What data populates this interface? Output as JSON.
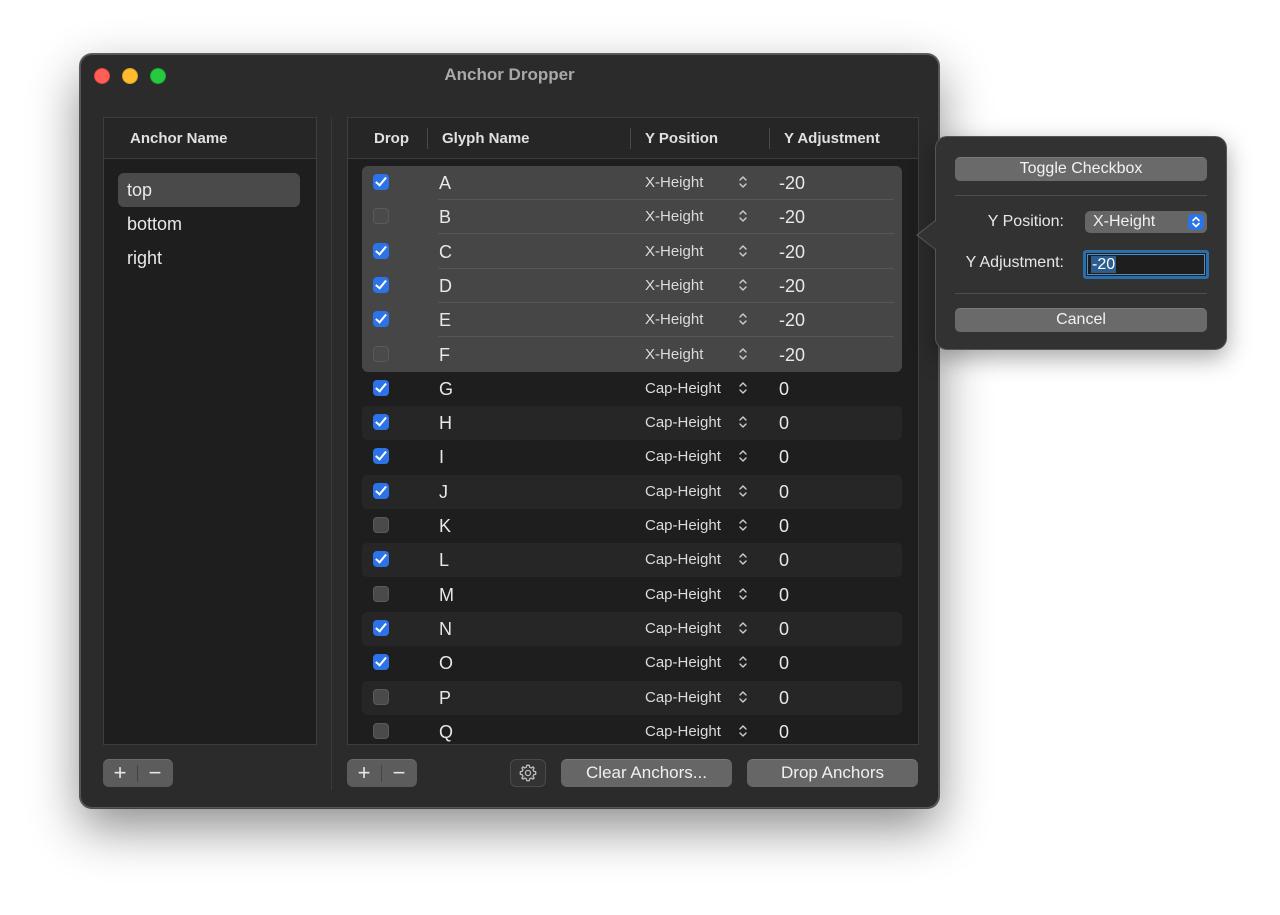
{
  "window": {
    "title": "Anchor Dropper"
  },
  "anchors": {
    "header": "Anchor Name",
    "items": [
      {
        "label": "top",
        "selected": true
      },
      {
        "label": "bottom",
        "selected": false
      },
      {
        "label": "right",
        "selected": false
      }
    ],
    "add_label": "+",
    "remove_label": "−"
  },
  "table": {
    "headers": {
      "drop": "Drop",
      "glyph": "Glyph Name",
      "ypos": "Y Position",
      "yadj": "Y Adjustment"
    },
    "rows": [
      {
        "checked": true,
        "glyph": "A",
        "ypos": "X-Height",
        "yadj": "-20"
      },
      {
        "checked": false,
        "glyph": "B",
        "ypos": "X-Height",
        "yadj": "-20"
      },
      {
        "checked": true,
        "glyph": "C",
        "ypos": "X-Height",
        "yadj": "-20"
      },
      {
        "checked": true,
        "glyph": "D",
        "ypos": "X-Height",
        "yadj": "-20"
      },
      {
        "checked": true,
        "glyph": "E",
        "ypos": "X-Height",
        "yadj": "-20"
      },
      {
        "checked": false,
        "glyph": "F",
        "ypos": "X-Height",
        "yadj": "-20"
      },
      {
        "checked": true,
        "glyph": "G",
        "ypos": "Cap-Height",
        "yadj": "0"
      },
      {
        "checked": true,
        "glyph": "H",
        "ypos": "Cap-Height",
        "yadj": "0"
      },
      {
        "checked": true,
        "glyph": "I",
        "ypos": "Cap-Height",
        "yadj": "0"
      },
      {
        "checked": true,
        "glyph": "J",
        "ypos": "Cap-Height",
        "yadj": "0"
      },
      {
        "checked": false,
        "glyph": "K",
        "ypos": "Cap-Height",
        "yadj": "0"
      },
      {
        "checked": true,
        "glyph": "L",
        "ypos": "Cap-Height",
        "yadj": "0"
      },
      {
        "checked": false,
        "glyph": "M",
        "ypos": "Cap-Height",
        "yadj": "0"
      },
      {
        "checked": true,
        "glyph": "N",
        "ypos": "Cap-Height",
        "yadj": "0"
      },
      {
        "checked": true,
        "glyph": "O",
        "ypos": "Cap-Height",
        "yadj": "0"
      },
      {
        "checked": false,
        "glyph": "P",
        "ypos": "Cap-Height",
        "yadj": "0"
      },
      {
        "checked": false,
        "glyph": "Q",
        "ypos": "Cap-Height",
        "yadj": "0"
      }
    ],
    "selected_rows": 6,
    "add_label": "+",
    "remove_label": "−"
  },
  "toolbar": {
    "gear_icon": "gear-icon",
    "clear_label": "Clear Anchors...",
    "drop_label": "Drop Anchors"
  },
  "popover": {
    "toggle_label": "Toggle Checkbox",
    "ypos_label": "Y Position:",
    "ypos_value": "X-Height",
    "yadj_label": "Y Adjustment:",
    "yadj_value": "-20",
    "cancel_label": "Cancel"
  },
  "colors": {
    "accent": "#2c73e8",
    "window_bg": "#2b2b2b",
    "pane_bg": "#1e1e1e"
  }
}
